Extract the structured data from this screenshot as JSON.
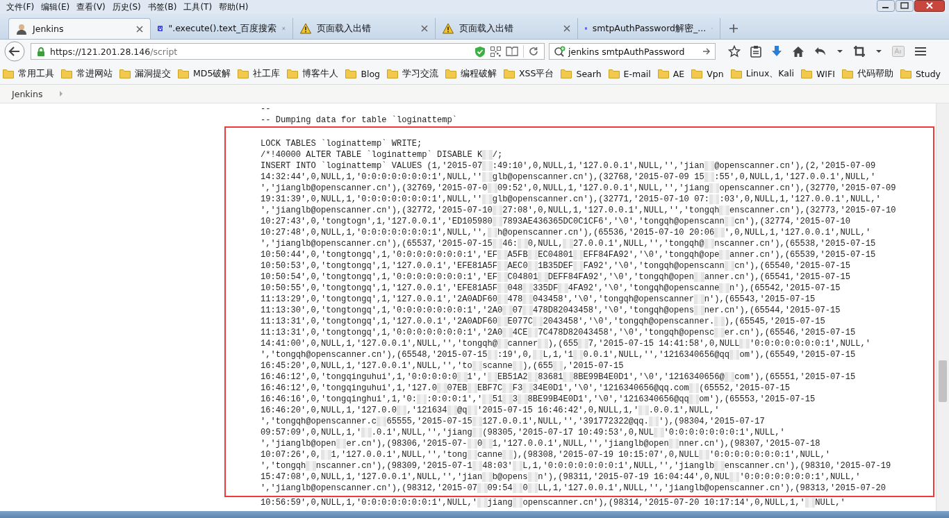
{
  "menu": [
    "文件(F)",
    "编辑(E)",
    "查看(V)",
    "历史(S)",
    "书签(B)",
    "工具(T)",
    "帮助(H)"
  ],
  "tabs": [
    {
      "title": "Jenkins",
      "kind": "avatar",
      "selected": true
    },
    {
      "title": "\".execute().text_百度搜索",
      "kind": "paw",
      "selected": false
    },
    {
      "title": "页面载入出错",
      "kind": "warning",
      "selected": false
    },
    {
      "title": "页面载入出错",
      "kind": "warning",
      "selected": false
    },
    {
      "title": "smtpAuthPassword解密_...",
      "kind": "paw",
      "selected": false
    }
  ],
  "address": {
    "host": "https://121.201.28.146",
    "path": "/script"
  },
  "search": {
    "value": "jenkins smtpAuthPassword"
  },
  "bookmarks": [
    "常用工具",
    "常进网站",
    "漏洞提交",
    "MD5破解",
    "社工库",
    "博客牛人",
    "Blog",
    "学习交流",
    "编程破解",
    "XSS平台",
    "Searh",
    "E-mail",
    "AE",
    "Vpn",
    "Linux、Kali",
    "WIFI",
    "代码帮助",
    "Study"
  ],
  "breadcrumb": "Jenkins",
  "code": {
    "header_lines": [
      "--",
      "-- Dumping data for table `loginattemp`"
    ],
    "highlighted_lines": [
      [
        "LOCK TABLES `loginattemp` WRITE;"
      ],
      [
        "/*!40000 ALTER TABLE `loginattemp` DISABLE K",
        "/;"
      ],
      [
        "INSERT INTO `loginattemp` VALUES (1,'2015-07",
        ":49:10',0,NULL,1,'127.0.0.1',NULL,'','jian",
        "@openscanner.cn'),(2,'2015-07-09"
      ],
      [
        "14:32:44',0,NULL,1,'0:0:0:0:0:0:0:1',NULL,''",
        "glb@openscanner.cn'),(32768,'2015-07-09 15",
        ":55',0,NULL,1,'127.0.0.1',NULL,'"
      ],
      [
        "','jianglb@openscanner.cn'),(32769,'2015-07-0",
        "09:52',0,NULL,1,'127.0.0.1',NULL,'','jiang",
        "openscanner.cn'),(32770,'2015-07-09"
      ],
      [
        "19:31:39',0,NULL,1,'0:0:0:0:0:0:0:1',NULL,''",
        "glb@openscanner.cn'),(32771,'2015-07-10 07:",
        ":03',0,NULL,1,'127.0.0.1',NULL,'"
      ],
      [
        "','jianglb@openscanner.cn'),(32772,'2015-07-10",
        "27:08',0,NULL,1,'127.0.0.1',NULL,'','tongqh",
        "enscanner.cn'),(32773,'2015-07-10"
      ],
      [
        "10:27:43',0,'tongtogn',1,'127.0.0.1','ED105980",
        "7893AE436365DC0C1CF6','\\0','tongqh@openscann",
        "cn'),(32774,'2015-07-10"
      ],
      [
        "10:27:48',0,NULL,1,'0:0:0:0:0:0:0:1',NULL,'',",
        "h@openscanner.cn'),(65536,'2015-07-10 20:06",
        "',0,NULL,1,'127.0.0.1',NULL,'"
      ],
      [
        "','jianglb@openscanner.cn'),(65537,'2015-07-15",
        "46:",
        "0,NULL,",
        "27.0.0.1',NULL,'','tongqh@",
        "nscanner.cn'),(65538,'2015-07-15"
      ],
      [
        "10:50:44',0,'tongtongq',1,'0:0:0:0:0:0:0:1','EF",
        "A5FB",
        "EC04801",
        "EFF84FA92','\\0','tongqh@ope",
        "anner.cn'),(65539,'2015-07-15"
      ],
      [
        "10:50:53',0,'tongtongq',1,'127.0.0.1','EFE81A5F",
        "AEC0",
        "1B35DEF",
        "FA92','\\0','tongqh@openscann",
        "cn'),(65540,'2015-07-15"
      ],
      [
        "10:50:54',0,'tongtongq',1,'0:0:0:0:0:0:0:1','EF",
        "C04801",
        "DEFF84FA92','\\0','tongqh@open",
        "anner.cn'),(65541,'2015-07-15"
      ],
      [
        "10:50:55',0,'tongtongq',1,'127.0.0.1','EFE81A5F",
        "048",
        "335DF",
        "4FA92','\\0','tongqh@openscanne",
        "n'),(65542,'2015-07-15"
      ],
      [
        "11:13:29',0,'tongtongq',1,'127.0.0.1','2A0ADF60",
        "478",
        "043458','\\0','tongqh@openscanner",
        "n'),(65543,'2015-07-15"
      ],
      [
        "11:13:30',0,'tongtongq',1,'0:0:0:0:0:0:0:1','2A0",
        "07",
        "478D82043458','\\0','tongqh@opens",
        "ner.cn'),(65544,'2015-07-15"
      ],
      [
        "11:13:31',0,'tongtongq',1,'127.0.0.1','2A0ADF60",
        "E077C",
        "2043458','\\0','tongqh@openscanner.",
        "),(65545,'2015-07-15"
      ],
      [
        "11:13:31',0,'tongtongq',1,'0:0:0:0:0:0:0:1','2A0",
        "4CE",
        "7C478D82043458','\\0','tongqh@opensc",
        "er.cn'),(65546,'2015-07-15"
      ],
      [
        "14:41:00',0,NULL,1,'127.0.0.1',NULL,'','tongqh@",
        "canner",
        "),(655",
        "7,'2015-07-15 14:41:58',0,NULL",
        "'0:0:0:0:0:0:0:1',NULL,'"
      ],
      [
        "','tongqh@openscanner.cn'),(65548,'2015-07-15",
        ":19',0,",
        "L,1,'1",
        "0.0.1',NULL,'','1216340656@qq",
        "om'),(65549,'2015-07-15"
      ],
      [
        "16:45:20',0,NULL,1,'127.0.0.1',NULL,'','to",
        "scanne",
        "),(655",
        ",'2015-07-15"
      ],
      [
        "16:46:12',0,'tongqinguhui',1,'0:0:0:0:0",
        "1','",
        "EB51A2",
        "83681",
        "8BE99B4E0D1','\\0','1216340656@",
        "com'),(65551,'2015-07-15"
      ],
      [
        "16:46:12',0,'tongqinguhui',1,'127.0",
        "07EB",
        "EBF7C",
        "F3",
        "34E0D1','\\0','1216340656@qq.com",
        "(65552,'2015-07-15"
      ],
      [
        "16:46:16',0,'tongqinghui',1,'0:",
        ":0:0:0:1','",
        "51",
        "3",
        "8BE99B4E0D1','\\0','1216340656@qq",
        "om'),(65553,'2015-07-15"
      ],
      [
        "16:46:20',0,NULL,1,'127.0.0",
        ",'121634",
        "@q",
        "'2015-07-15 16:46:42',0,NULL,1,'",
        ".0.0.1',NULL,'"
      ],
      [
        "','tongqh@openscanner.c",
        "65555,'2015-07-15",
        "127.0.0.1',NULL,'','391772322@qq.",
        "'),(98304,'2015-07-17"
      ],
      [
        "09:57:09',0,NULL,1,'",
        ".0.1',NULL,'','jiang",
        "(98305,'2015-07-17 10:49:53',0,NUL",
        "'0:0:0:0:0:0:0:1',NULL,'"
      ],
      [
        "','jianglb@open",
        "er.cn'),(98306,'2015-07-",
        "0",
        "1,'127.0.0.1',NULL,'','jianglb@open",
        "nner.cn'),(98307,'2015-07-18"
      ],
      [
        "10:07:26',0,",
        "1,'127.0.0.1',NULL,'','tong",
        "canne",
        "),(98308,'2015-07-19 10:15:07',0,NULL",
        "'0:0:0:0:0:0:0:1',NULL,'"
      ],
      [
        "','tongqh",
        "nscanner.cn'),(98309,'2015-07-1",
        "48:03'",
        "L,1,'0:0:0:0:0:0:0:1',NULL,'','jianglb",
        "enscanner.cn'),(98310,'2015-07-19"
      ],
      [
        "15:47:08',0,NULL,1,'127.0.0.1',NULL,'','jian",
        "b@opens",
        "n'),(98311,'2015-07-19 16:04:44',0,NUL",
        "'0:0:0:0:0:0:0:1',NULL,'"
      ],
      [
        "','jianglb@openscanner.cn'),(98312,'2015-07",
        "09:54",
        "0",
        "LL,1,'127.0.0.1',NULL,'','jianglb@openscanner.cn'),(98313,'2015-07-20"
      ]
    ],
    "trailing_lines": [
      [
        "10:56:59',0,NULL,1,'0:0:0:0:0:0:0:1',NULL,'",
        "jiang",
        "openscanner.cn'),(98314,'2015-07-20 10:17:14',0,NULL,1,'",
        "NULL,'"
      ]
    ]
  }
}
